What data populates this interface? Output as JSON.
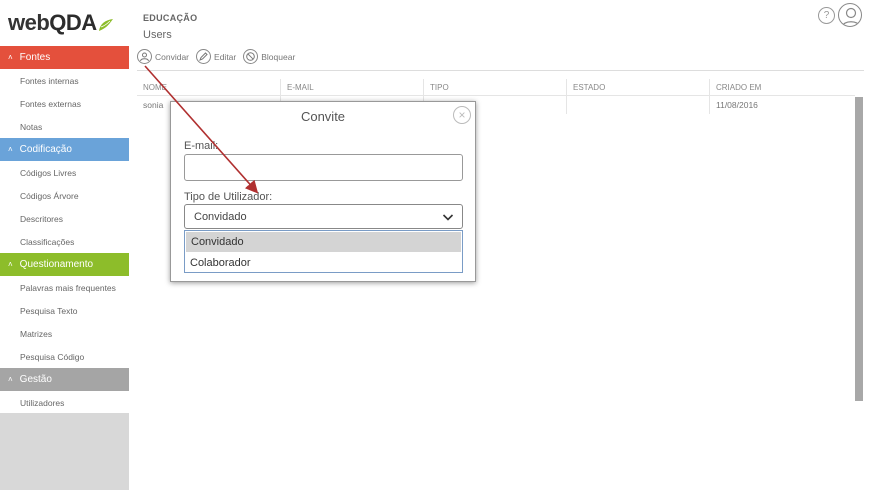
{
  "app": {
    "logo_web": "web",
    "logo_qda": "QDA"
  },
  "sidebar": {
    "sections": [
      {
        "label": "Fontes",
        "items": [
          "Fontes internas",
          "Fontes externas",
          "Notas"
        ]
      },
      {
        "label": "Codificação",
        "items": [
          "Códigos Livres",
          "Códigos Árvore",
          "Descritores",
          "Classificações"
        ]
      },
      {
        "label": "Questionamento",
        "items": [
          "Palavras mais frequentes",
          "Pesquisa Texto",
          "Matrizes",
          "Pesquisa Código"
        ]
      },
      {
        "label": "Gestão",
        "items": [
          "Utilizadores"
        ]
      }
    ]
  },
  "header": {
    "subtitle": "EDUCAÇÃO",
    "title": "Users",
    "help_glyph": "?"
  },
  "toolbar": {
    "invite_label": "Convidar",
    "edit_label": "Editar",
    "block_label": "Bloquear"
  },
  "table": {
    "columns": [
      "NOME",
      "E-MAIL",
      "TIPO",
      "ESTADO",
      "CRIADO EM"
    ],
    "rows": [
      {
        "nome": "sonia",
        "email": "",
        "tipo": "",
        "estado": "",
        "criado_em": "11/08/2016"
      }
    ]
  },
  "modal": {
    "title": "Convite",
    "close_glyph": "×",
    "email_label": "E-mail:",
    "email_value": "",
    "type_label": "Tipo de Utilizador:",
    "type_selected": "Convidado",
    "options": [
      "Convidado",
      "Colaborador"
    ]
  },
  "colors": {
    "fontes": "#e4503c",
    "codificacao": "#6aa3d9",
    "questionamento": "#8dbd2a",
    "gestao": "#a5a5a5",
    "arrow": "#b03030"
  }
}
